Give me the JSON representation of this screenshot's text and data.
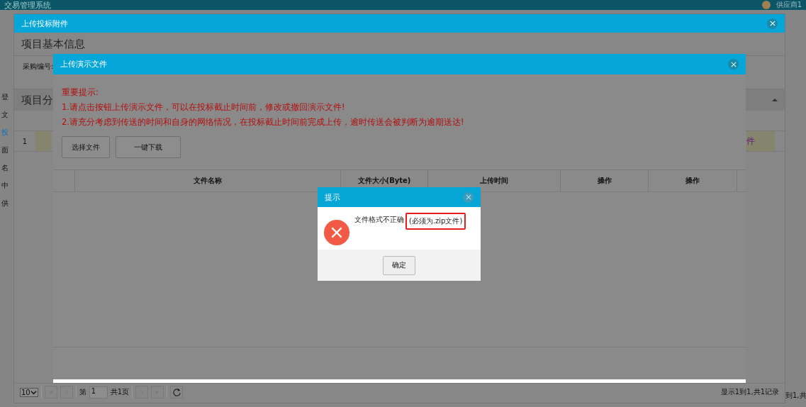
{
  "app": {
    "title": "交易管理系统",
    "user": "供应商1",
    "sidebar_items": [
      {
        "label": "登",
        "selected": false
      },
      {
        "label": "文",
        "selected": false
      },
      {
        "label": "投",
        "selected": true
      },
      {
        "label": "面",
        "selected": false
      },
      {
        "label": "名",
        "selected": false
      },
      {
        "label": "中",
        "selected": false
      },
      {
        "label": "供",
        "selected": false
      }
    ],
    "footer_text": "到1,共"
  },
  "attachment_dialog": {
    "title": "上传投标附件",
    "section_title": "项目基本信息",
    "field_label": "采购编号:",
    "section2_title": "项目分",
    "row_index": "1",
    "cell_text": "件",
    "pagination": {
      "page_size": "10",
      "page_label": "第",
      "page": "1",
      "total_pages": "共1页",
      "summary": "显示1到1,共1记录"
    }
  },
  "upload_dialog": {
    "title": "上传演示文件",
    "notice_title": "重要提示:",
    "notices": [
      "1.请点击按钮上传演示文件，可以在投标截止时间前，修改或撤回演示文件!",
      "2.请充分考虑到传送的时间和自身的网络情况，在投标截止时间前完成上传，逾时传送会被判断为逾期送达!"
    ],
    "buttons": [
      "选择文件",
      "一键下载"
    ],
    "columns": [
      "文件名称",
      "文件大小(Byte)",
      "上传时间",
      "操作",
      "操作"
    ]
  },
  "alert": {
    "title": "提示",
    "message": "文件格式不正确",
    "highlight": "(必须为.zip文件)",
    "button": "确定"
  }
}
